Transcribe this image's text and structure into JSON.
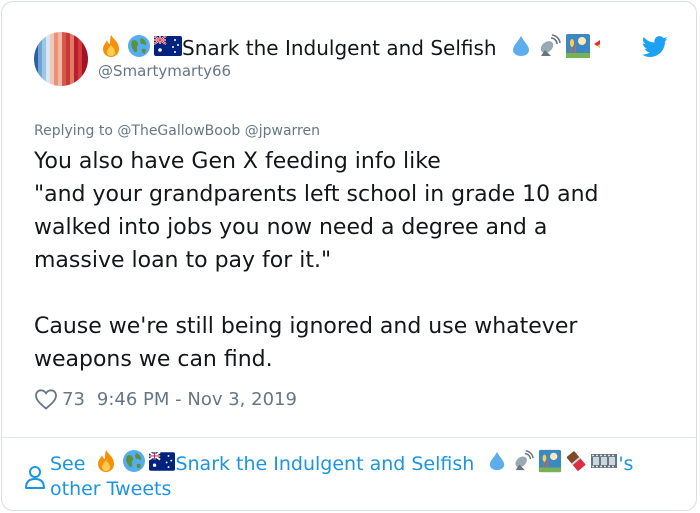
{
  "tweet": {
    "author": {
      "display_name": "Snark the Indulgent and Selfish",
      "handle": "@Smartymarty66",
      "avatar_icon": "warming-stripes-avatar"
    },
    "bird_icon": "twitter-bird-icon",
    "reply_prefix": "Replying to",
    "reply_mentions": "@TheGallowBoob @jpwarren",
    "body_lines_1": [
      "You also have Gen X feeding info like",
      "\"and your grandparents left school in grade 10 and",
      "walked into jobs you now need a degree and a",
      "massive loan to pay for it.\""
    ],
    "body_lines_2": [
      "Cause we're still being ignored and use whatever",
      "weapons we can find."
    ],
    "likes": "73",
    "timestamp": "9:46 PM - Nov 3, 2019"
  },
  "footer": {
    "see": "See",
    "name": "Snark the Indulgent and Selfish",
    "possessive": "'s",
    "other_tweets": "other Tweets"
  },
  "colors": {
    "link": "#1b95e0",
    "muted": "#657786",
    "text": "#14171a",
    "twitter_blue": "#1da1f2"
  }
}
